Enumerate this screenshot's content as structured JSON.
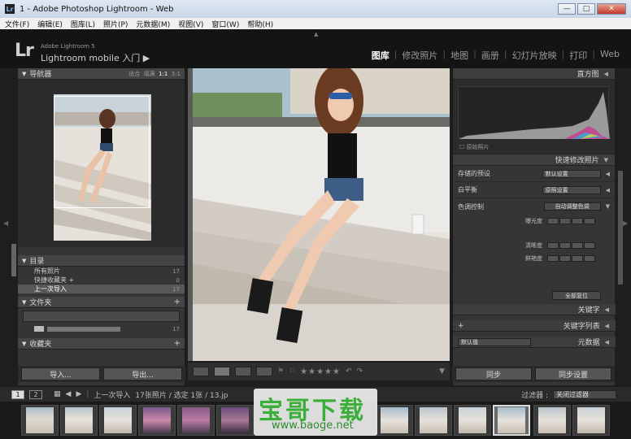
{
  "window": {
    "title": "1 - Adobe Photoshop Lightroom - Web",
    "app_icon": "Lr",
    "min": "—",
    "max": "□",
    "close": "✕"
  },
  "menu": [
    "文件(F)",
    "编辑(E)",
    "图库(L)",
    "照片(P)",
    "元数据(M)",
    "视图(V)",
    "窗口(W)",
    "帮助(H)"
  ],
  "identity": {
    "logo": "Lr",
    "product": "Adobe Lightroom 5",
    "subtitle": "Lightroom mobile 入门",
    "arrow": "▶"
  },
  "modules": [
    {
      "label": "图库",
      "active": true
    },
    {
      "label": "修改照片",
      "active": false
    },
    {
      "label": "地图",
      "active": false
    },
    {
      "label": "画册",
      "active": false
    },
    {
      "label": "幻灯片放映",
      "active": false
    },
    {
      "label": "打印",
      "active": false
    },
    {
      "label": "Web",
      "active": false
    }
  ],
  "navigator": {
    "title": "导航器",
    "zoom": [
      "适合",
      "填满",
      "1:1",
      "3:1"
    ]
  },
  "catalog": {
    "title": "目录",
    "items": [
      {
        "label": "所有照片",
        "count": "17",
        "selected": false
      },
      {
        "label": "快捷收藏夹 +",
        "count": "0",
        "selected": false
      },
      {
        "label": "上一次导入",
        "count": "17",
        "selected": true
      }
    ]
  },
  "folders": {
    "title": "文件夹",
    "count": "17"
  },
  "collections": {
    "title": "收藏夹"
  },
  "left_buttons": {
    "import": "导入...",
    "export": "导出..."
  },
  "histogram": {
    "title": "直方图",
    "original_photo": "原始照片"
  },
  "quick_develop": {
    "title": "快速修改照片",
    "saved_preset": {
      "label": "存储的预设",
      "value": "默认设置"
    },
    "white_balance": {
      "label": "白平衡",
      "value": "原照设置"
    },
    "tone_control": {
      "label": "色调控制",
      "auto_tone": "自动调整色调"
    },
    "exposure": "曝光度",
    "clarity": "清晰度",
    "vibrance": "鲜艳度",
    "reset_all": "全部复位"
  },
  "keywords": {
    "title": "关键字"
  },
  "keyword_list": {
    "title": "关键字列表",
    "plus": "+"
  },
  "metadata": {
    "title": "元数据",
    "preset": "默认值"
  },
  "right_buttons": {
    "sync": "同步",
    "sync_settings": "同步设置"
  },
  "filmstrip_bar": {
    "page1": "1",
    "page2": "2",
    "source": "上一次导入",
    "info": "17张照片 / 选定 1张 / 13.jp",
    "filter_label": "过滤器 :",
    "filter_value": "关闭过滤器"
  },
  "watermark": {
    "brand": "宝哥下载",
    "url": "www.baoge.net"
  },
  "colors": {
    "accent_watermark": "#3cae3a",
    "panel_bg": "#353535",
    "identity_bg": "#141414"
  }
}
